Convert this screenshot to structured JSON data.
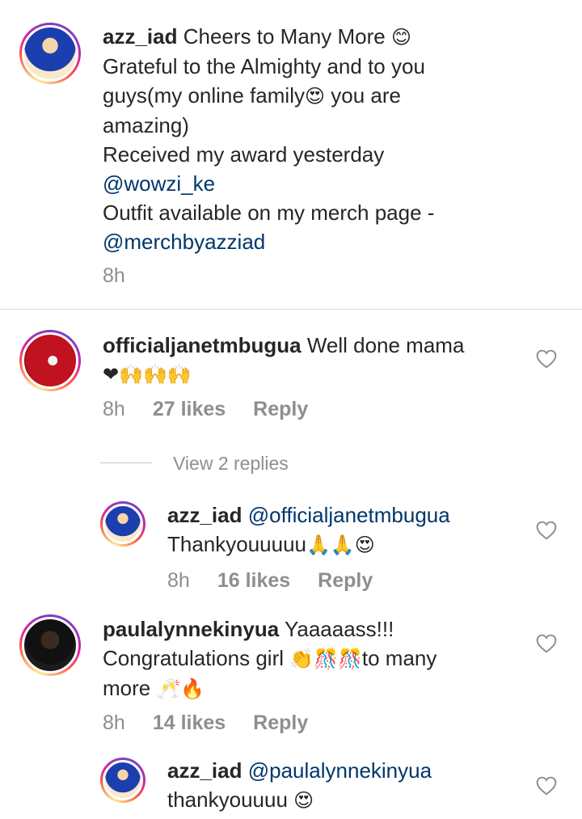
{
  "caption": {
    "username": "azz_iad",
    "line1": "Cheers to Many More",
    "line1_emoji": "😊",
    "line2": "Grateful to the Almighty and to you",
    "line3a": "guys(my online family",
    "line3_emoji": "😍",
    "line3b": " you are",
    "line4": "amazing)",
    "line5": "Received my award yesterday",
    "mention1": "@wowzi_ke",
    "line7": "Outfit available on my merch page -",
    "mention2": "@merchbyazziad",
    "time": "8h"
  },
  "comments": [
    {
      "username": "officialjanetmbugua",
      "text": "Well done mama",
      "emojis": "❤🙌🙌🙌",
      "time": "8h",
      "likes": "27 likes",
      "reply_label": "Reply",
      "view_replies": "View 2 replies"
    },
    {
      "username": "azz_iad",
      "mention": "@officialjanetmbugua",
      "text": "Thankyouuuuu",
      "emojis": "🙏🙏😍",
      "time": "8h",
      "likes": "16 likes",
      "reply_label": "Reply"
    },
    {
      "username": "paulalynnekinyua",
      "text": "Yaaaaass!!!",
      "line2": "Congratulations girl ",
      "line2_emojis": "👏🎊🎊",
      "line2b": "to many",
      "line3": "more ",
      "line3_emojis": "🥂🔥",
      "time": "8h",
      "likes": "14 likes",
      "reply_label": "Reply"
    },
    {
      "username": "azz_iad",
      "mention": "@paulalynnekinyua",
      "text": "thankyouuuu ",
      "emojis": "😍"
    }
  ],
  "icons": {
    "like": "heart-outline-icon"
  },
  "colors": {
    "mention": "#00376b",
    "meta": "#8e8e8e",
    "text": "#262626"
  }
}
